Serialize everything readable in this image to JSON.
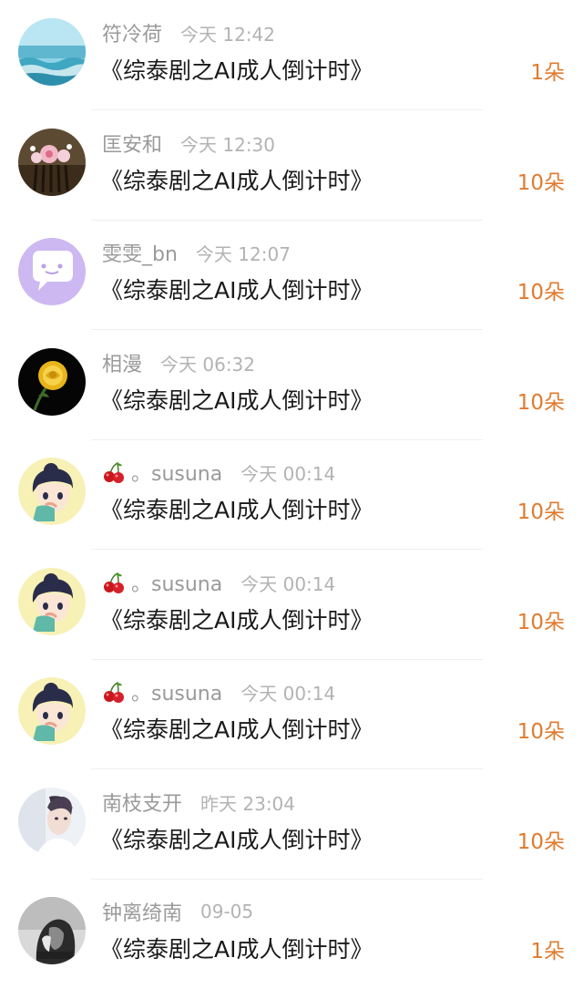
{
  "gifts": [
    {
      "user": "符冷荷",
      "time": "今天 12:42",
      "title": "《综泰剧之AI成人倒计时》",
      "amount": "1朵",
      "avatar": "sea-avatar"
    },
    {
      "user": "匡安和",
      "time": "今天 12:30",
      "title": "《综泰剧之AI成人倒计时》",
      "amount": "10朵",
      "avatar": "hairpin-flower-avatar"
    },
    {
      "user": "雯雯_bn",
      "time": "今天 12:07",
      "title": "《综泰剧之AI成人倒计时》",
      "amount": "10朵",
      "avatar": "chat-bubble-avatar"
    },
    {
      "user": "相漫",
      "time": "今天 06:32",
      "title": "《综泰剧之AI成人倒计时》",
      "amount": "10朵",
      "avatar": "yellow-rose-avatar"
    },
    {
      "user": "。susuna",
      "time": "今天 00:14",
      "title": "《综泰剧之AI成人倒计时》",
      "amount": "10朵",
      "avatar": "cartoon-boy-avatar",
      "prefix_icon": "cherry-icon"
    },
    {
      "user": "。susuna",
      "time": "今天 00:14",
      "title": "《综泰剧之AI成人倒计时》",
      "amount": "10朵",
      "avatar": "cartoon-boy-avatar",
      "prefix_icon": "cherry-icon"
    },
    {
      "user": "。susuna",
      "time": "今天 00:14",
      "title": "《综泰剧之AI成人倒计时》",
      "amount": "10朵",
      "avatar": "cartoon-boy-avatar",
      "prefix_icon": "cherry-icon"
    },
    {
      "user": "南枝支开",
      "time": "昨天 23:04",
      "title": "《综泰剧之AI成人倒计时》",
      "amount": "10朵",
      "avatar": "portrait-avatar"
    },
    {
      "user": "钟离绮南",
      "time": "09-05",
      "title": "《综泰剧之AI成人倒计时》",
      "amount": "1朵",
      "avatar": "bw-photo-avatar"
    }
  ],
  "colors": {
    "username": "#9a9a9a",
    "time": "#b3b3b3",
    "title": "#1a1a1a",
    "amount": "#e07b2e"
  }
}
